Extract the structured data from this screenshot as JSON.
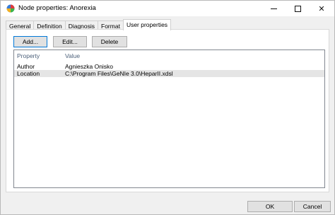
{
  "window": {
    "title": "Node properties: Anorexia",
    "icon": "genie-app-icon"
  },
  "tabs": [
    {
      "label": "General"
    },
    {
      "label": "Definition"
    },
    {
      "label": "Diagnosis"
    },
    {
      "label": "Format"
    },
    {
      "label": "User properties",
      "active": true
    }
  ],
  "toolbar": {
    "add_label": "Add...",
    "edit_label": "Edit...",
    "delete_label": "Delete"
  },
  "table": {
    "columns": [
      "Property",
      "Value"
    ],
    "rows": [
      {
        "property": "Author",
        "value": "Agnieszka Onisko"
      },
      {
        "property": "Location",
        "value": "C:\\Program Files\\GeNIe 3.0\\HeparII.xdsl"
      }
    ]
  },
  "footer": {
    "ok_label": "OK",
    "cancel_label": "Cancel"
  }
}
